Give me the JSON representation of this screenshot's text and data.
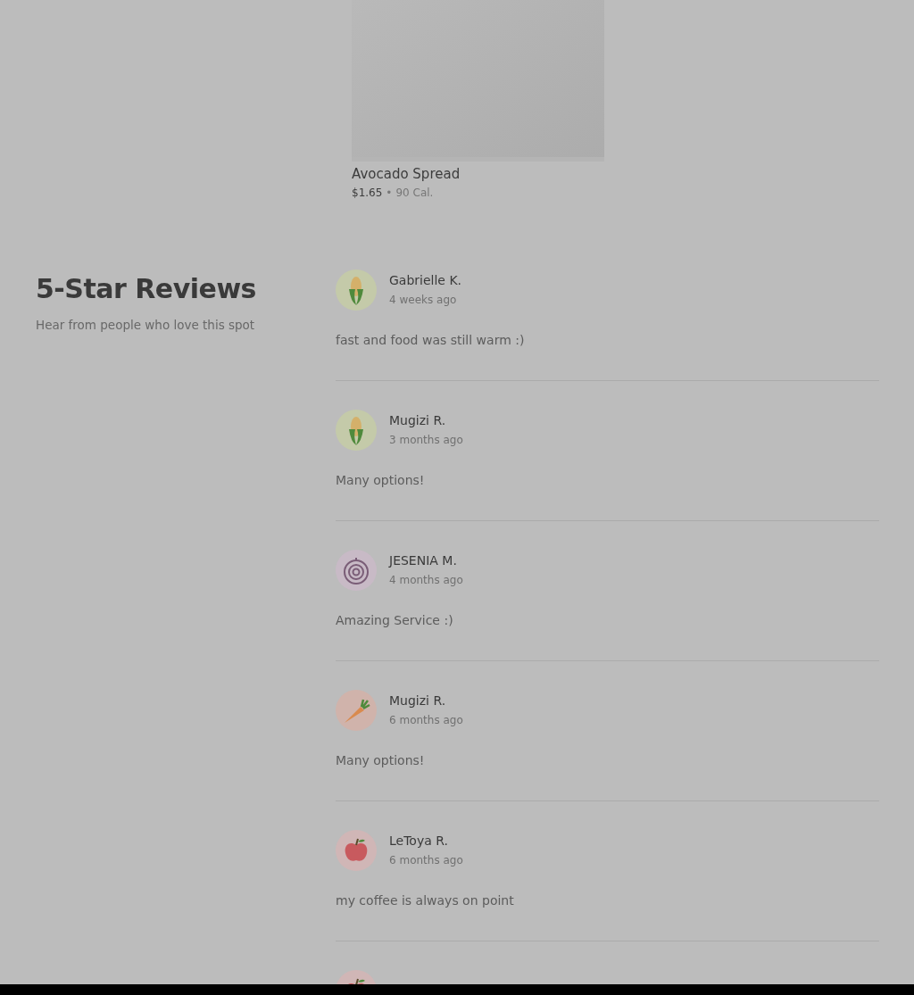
{
  "menu_item": {
    "kind": "picture",
    "title": "Avocado Spread",
    "price": "$1.65",
    "separator": "•",
    "calories": "90 Cal."
  },
  "reviews_section": {
    "title": "5-Star Reviews",
    "subtitle": "Hear from people who love this spot",
    "reviews": [
      {
        "kind": "corn",
        "name": "Gabrielle K.",
        "time": "4 weeks ago",
        "comment": "fast and food was still warm :)"
      },
      {
        "kind": "corn",
        "name": "Mugizi R.",
        "time": "3 months ago",
        "comment": "Many options!"
      },
      {
        "kind": "onion",
        "name": "JESENIA M.",
        "time": "4 months ago",
        "comment": "Amazing Service :)"
      },
      {
        "kind": "carrot",
        "name": "Mugizi R.",
        "time": "6 months ago",
        "comment": "Many options!"
      },
      {
        "kind": "apple",
        "name": "LeToya R.",
        "time": "6 months ago",
        "comment": "my coffee is always on point"
      },
      {
        "kind": "apple"
      }
    ]
  }
}
